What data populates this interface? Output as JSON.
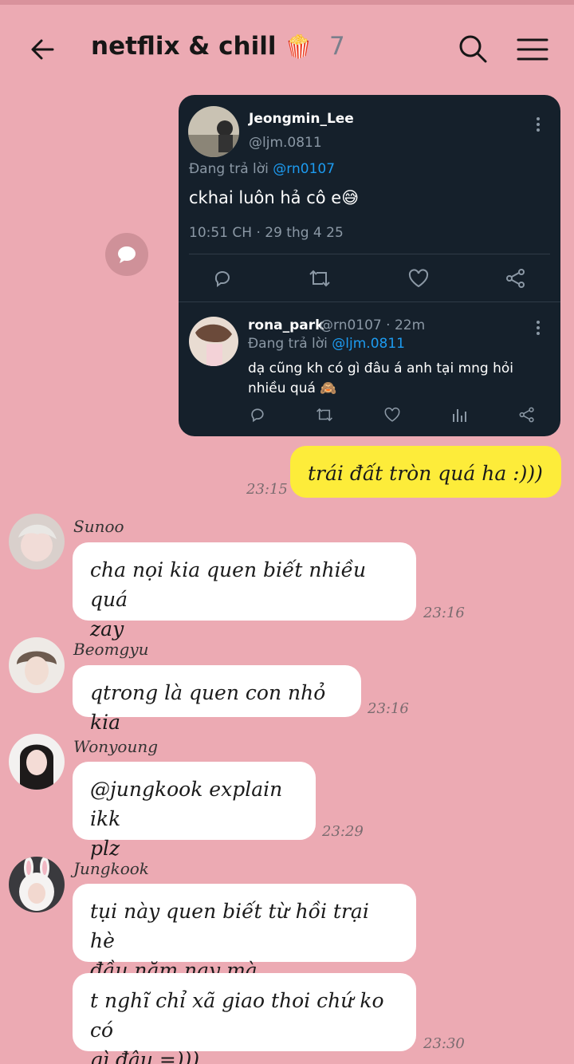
{
  "header": {
    "title": "netflix & chill",
    "emoji": "🍿",
    "member_count": "7"
  },
  "tweet": {
    "author_name": "Jeongmin_Lee",
    "author_handle": "@ljm.0811",
    "replying_prefix": "Đang trả lời ",
    "replying_to": "@rn0107",
    "text": "ckhai luôn hả cô e😅",
    "timestamp": "10:51 CH · 29 thg 4 25",
    "reply": {
      "author_name": "rona_park",
      "meta": "@rn0107 · 22m",
      "replying_prefix": "Đang trả lời ",
      "replying_to": "@ljm.0811",
      "text": "dạ cũng kh có gì đâu á anh tại mng hỏi nhiều quá 🙈"
    }
  },
  "messages": [
    {
      "sender": "",
      "text": "trái đất tròn quá ha :)))",
      "time": "23:15",
      "mine": true
    },
    {
      "sender": "Sunoo",
      "lines": [
        "cha nọi kia quen biết nhiều quá",
        "zay"
      ],
      "time": "23:16"
    },
    {
      "sender": "Beomgyu",
      "text": "qtrong là quen con nhỏ kia",
      "time": "23:16"
    },
    {
      "sender": "Wonyoung",
      "lines": [
        "@jungkook explain ikk",
        "plz"
      ],
      "time": "23:29"
    },
    {
      "sender": "Jungkook",
      "lines": [
        "tụi này quen biết từ hồi trại hè",
        "đầu năm nay mà"
      ],
      "time": ""
    },
    {
      "sender": "",
      "lines": [
        "t nghĩ chỉ xã giao thoi chứ ko có",
        "gì đâu =)))"
      ],
      "time": "23:30"
    }
  ],
  "colors": {
    "background": "#ecaab3",
    "my_bubble": "#fdec3a",
    "their_bubble": "#ffffff",
    "tweet_card": "#15202b",
    "link_blue": "#1d9bf0"
  },
  "icons": [
    "back-arrow-icon",
    "search-icon",
    "hamburger-menu-icon",
    "share-bubble-icon",
    "reply-icon",
    "retweet-icon",
    "like-icon",
    "share-icon",
    "views-icon",
    "more-icon"
  ]
}
